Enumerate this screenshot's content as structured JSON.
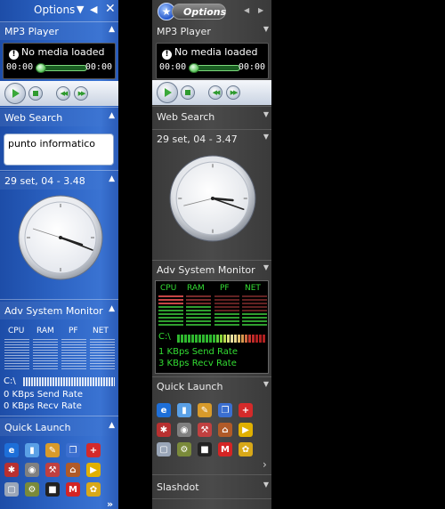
{
  "blue_sidebar": {
    "header": {
      "options_label": "Options"
    },
    "mp3": {
      "title": "MP3 Player",
      "status": "No media loaded",
      "time_elapsed": "00:00",
      "time_total": "00:00"
    },
    "web_search": {
      "title": "Web Search",
      "query": "punto informatico"
    },
    "clock": {
      "title": "29 set, 04 - 3.48"
    },
    "sysmon": {
      "title": "Adv System Monitor",
      "columns": [
        "CPU",
        "RAM",
        "PF",
        "NET"
      ],
      "drive": "C:\\",
      "send_rate": "0 KBps Send Rate",
      "recv_rate": "0 KBps Recv Rate"
    },
    "quick_launch": {
      "title": "Quick Launch",
      "more": "»"
    }
  },
  "dark_sidebar": {
    "header": {
      "options_label": "Options"
    },
    "mp3": {
      "title": "MP3 Player",
      "status": "No media loaded",
      "time_elapsed": "00:00",
      "time_total": "00:00"
    },
    "web_search": {
      "title": "Web Search"
    },
    "clock": {
      "title": "29 set, 04 - 3.47"
    },
    "sysmon": {
      "title": "Adv System Monitor",
      "columns": [
        "CPU",
        "RAM",
        "PF",
        "NET"
      ],
      "drive": "C:\\",
      "send_rate": "1 KBps Send Rate",
      "recv_rate": "3 KBps Recv Rate"
    },
    "quick_launch": {
      "title": "Quick Launch",
      "more": "›"
    },
    "slashdot": {
      "title": "Slashdot"
    }
  },
  "quick_launch_icons": [
    {
      "name": "ie-icon",
      "glyph": "e",
      "color": "#1e6fd8"
    },
    {
      "name": "mycomputer-icon",
      "glyph": "▮",
      "color": "#5aa0e6"
    },
    {
      "name": "pencil-icon",
      "glyph": "✎",
      "color": "#d89a2a"
    },
    {
      "name": "windows-icon",
      "glyph": "❐",
      "color": "#3b6fd0"
    },
    {
      "name": "firstaid-icon",
      "glyph": "+",
      "color": "#d42a2a"
    },
    {
      "name": "bug-icon",
      "glyph": "✱",
      "color": "#b83030"
    },
    {
      "name": "cd-icon",
      "glyph": "◉",
      "color": "#808080"
    },
    {
      "name": "tool-icon",
      "glyph": "⚒",
      "color": "#c04040"
    },
    {
      "name": "home-icon",
      "glyph": "⌂",
      "color": "#b05a28"
    },
    {
      "name": "media-icon",
      "glyph": "▶",
      "color": "#e0b000"
    },
    {
      "name": "window-icon",
      "glyph": "▢",
      "color": "#9aa6b8"
    },
    {
      "name": "tools-icon",
      "glyph": "⚙",
      "color": "#7a8a3a"
    },
    {
      "name": "square-icon",
      "glyph": "■",
      "color": "#222222"
    },
    {
      "name": "m-icon",
      "glyph": "M",
      "color": "#d42424"
    },
    {
      "name": "flower-icon",
      "glyph": "✿",
      "color": "#d8a818"
    }
  ],
  "colors": {
    "blue_panel": "#2b62c2",
    "dark_panel": "#454545",
    "monitor_green": "#33dd33"
  }
}
